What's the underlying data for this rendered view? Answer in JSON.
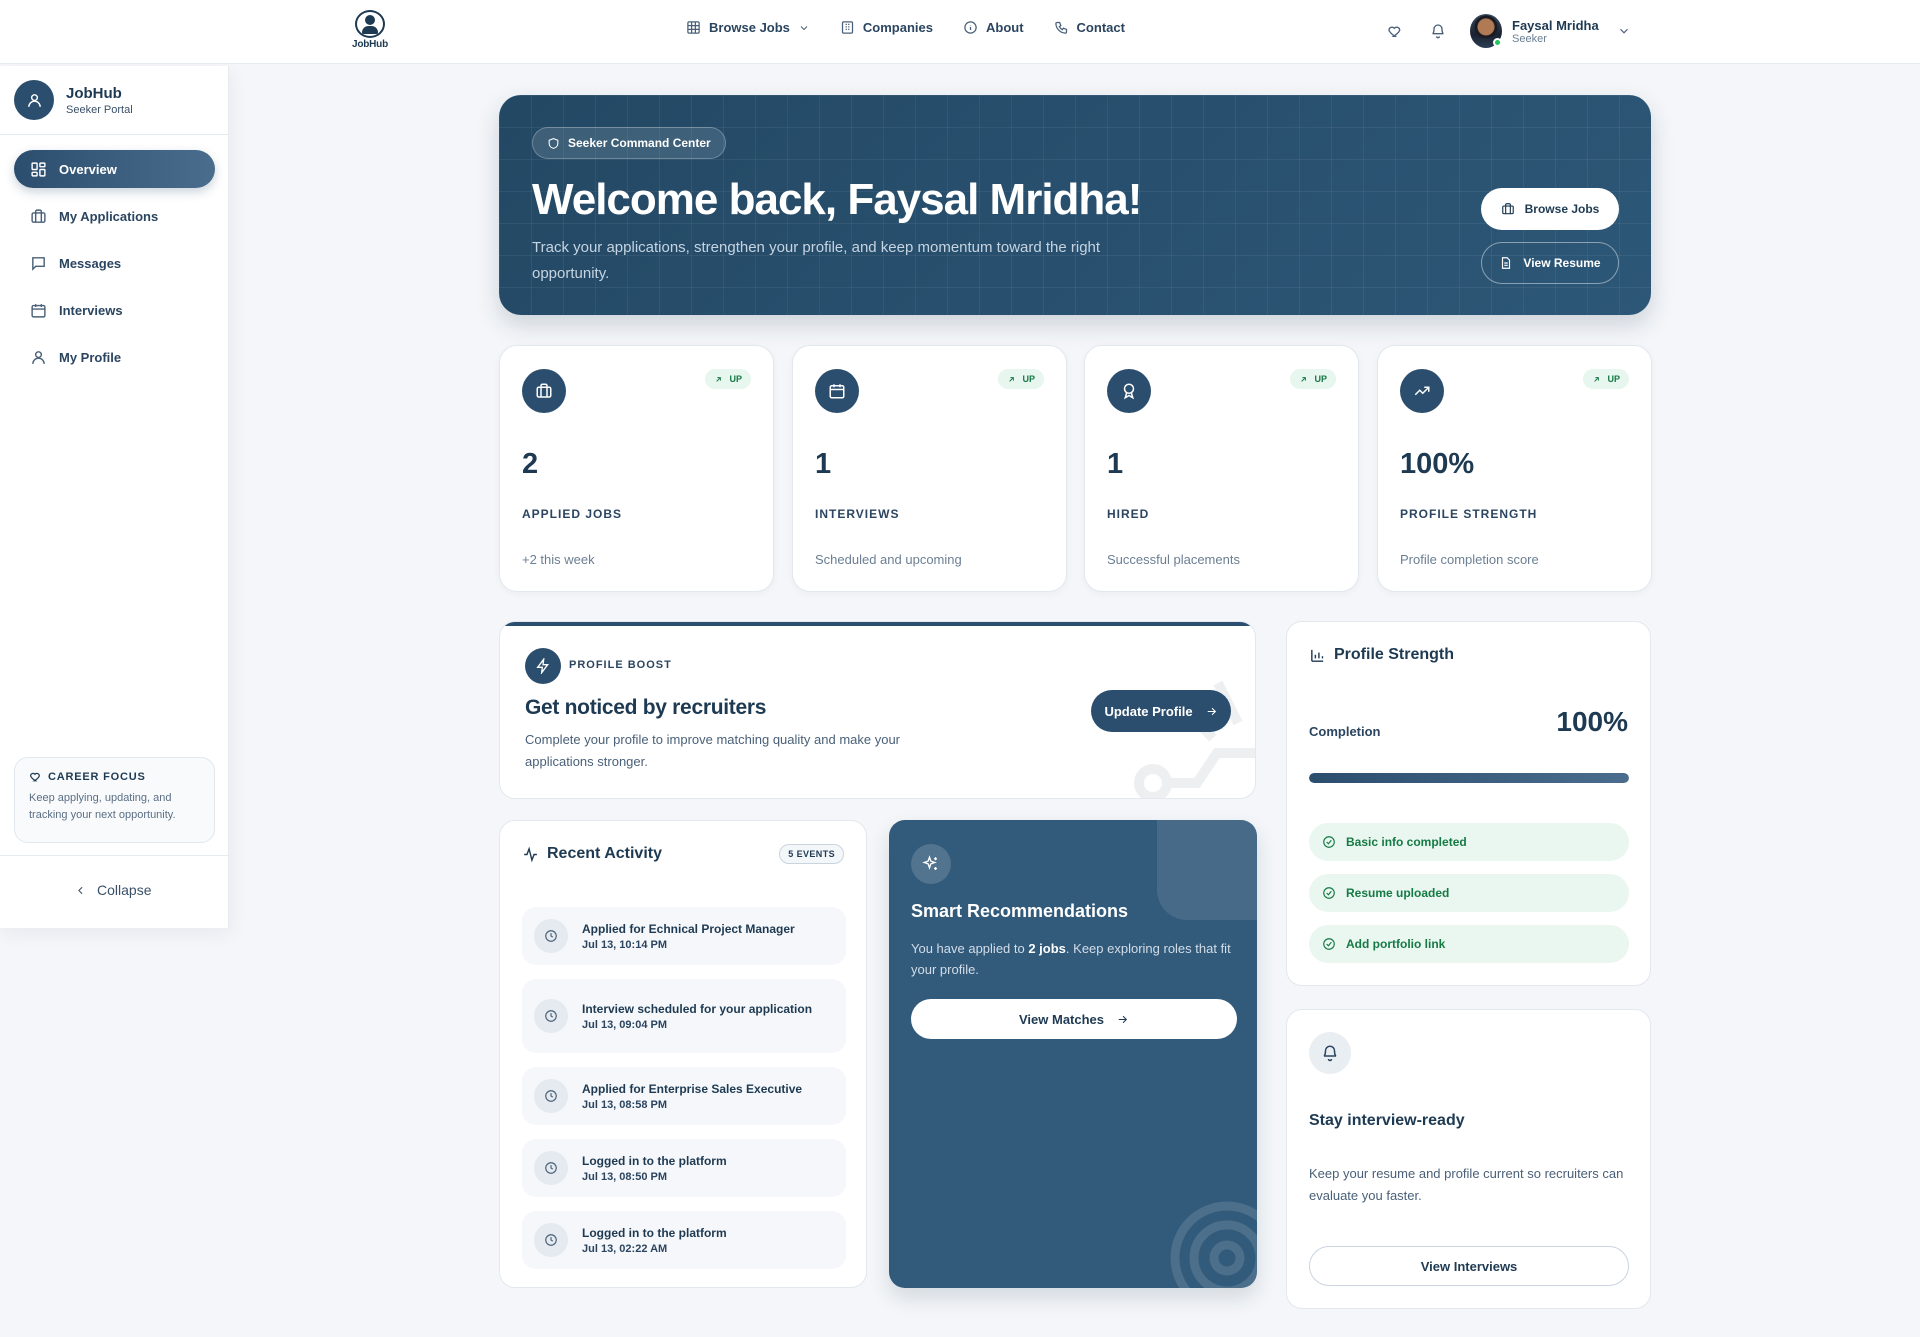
{
  "topbar": {
    "logo_text": "JobHub",
    "nav": [
      {
        "label": "Browse Jobs",
        "icon": "grid-icon",
        "has_dropdown": true
      },
      {
        "label": "Companies",
        "icon": "building-icon"
      },
      {
        "label": "About",
        "icon": "info-icon"
      },
      {
        "label": "Contact",
        "icon": "phone-icon"
      }
    ],
    "user": {
      "name": "Faysal Mridha",
      "role": "Seeker",
      "online": true
    }
  },
  "sidebar": {
    "brand_title": "JobHub",
    "brand_subtitle": "Seeker Portal",
    "items": [
      {
        "label": "Overview",
        "icon": "dashboard-icon",
        "active": true
      },
      {
        "label": "My Applications",
        "icon": "briefcase-icon"
      },
      {
        "label": "Messages",
        "icon": "message-icon"
      },
      {
        "label": "Interviews",
        "icon": "calendar-icon"
      },
      {
        "label": "My Profile",
        "icon": "user-icon"
      }
    ],
    "focus_title": "CAREER FOCUS",
    "focus_text": "Keep applying, updating, and tracking your next opportunity.",
    "collapse_label": "Collapse"
  },
  "hero": {
    "badge": "Seeker Command Center",
    "title": "Welcome back, Faysal Mridha!",
    "subtitle": "Track your applications, strengthen your profile, and keep momentum toward the right opportunity.",
    "browse_label": "Browse Jobs",
    "resume_label": "View Resume"
  },
  "stats": [
    {
      "value": "2",
      "label": "APPLIED JOBS",
      "note": "+2 this week",
      "trend": "UP",
      "icon": "briefcase-icon"
    },
    {
      "value": "1",
      "label": "INTERVIEWS",
      "note": "Scheduled and upcoming",
      "trend": "UP",
      "icon": "calendar-icon"
    },
    {
      "value": "1",
      "label": "HIRED",
      "note": "Successful placements",
      "trend": "UP",
      "icon": "award-icon"
    },
    {
      "value": "100%",
      "label": "PROFILE STRENGTH",
      "note": "Profile completion score",
      "trend": "UP",
      "icon": "trending-up-icon"
    }
  ],
  "boost": {
    "kicker": "PROFILE BOOST",
    "title": "Get noticed by recruiters",
    "text": "Complete your profile to improve matching quality and make your applications stronger.",
    "button": "Update Profile"
  },
  "activity": {
    "title": "Recent Activity",
    "count_label": "5 EVENTS",
    "items": [
      {
        "title": "Applied for Echnical Project Manager",
        "time": "Jul 13, 10:14 PM"
      },
      {
        "title": "Interview scheduled for your application",
        "time": "Jul 13, 09:04 PM"
      },
      {
        "title": "Applied for Enterprise Sales Executive",
        "time": "Jul 13, 08:58 PM"
      },
      {
        "title": "Logged in to the platform",
        "time": "Jul 13, 08:50 PM"
      },
      {
        "title": "Logged in to the platform",
        "time": "Jul 13, 02:22 AM"
      }
    ]
  },
  "smart": {
    "title": "Smart Recommendations",
    "text_before": "You have applied to ",
    "text_bold": "2 jobs",
    "text_after": ". Keep exploring roles that fit your profile.",
    "button": "View Matches"
  },
  "strength": {
    "title": "Profile Strength",
    "completion_label": "Completion",
    "completion_value": "100%",
    "completion_fraction": 1.0,
    "checks": [
      "Basic info completed",
      "Resume uploaded",
      "Add portfolio link"
    ]
  },
  "ready": {
    "title": "Stay interview-ready",
    "text": "Keep your resume and profile current so recruiters can evaluate you faster.",
    "button": "View Interviews"
  },
  "colors": {
    "primary": "#2c4e6e",
    "success": "#167a45",
    "success_bg": "#eaf7f0"
  }
}
